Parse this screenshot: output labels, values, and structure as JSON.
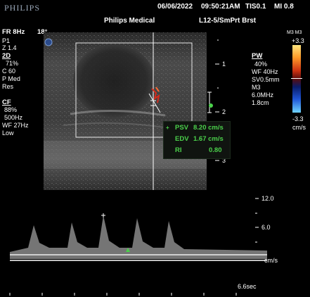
{
  "header": {
    "brand": "PHILIPS",
    "date": "06/06/2022",
    "time": "09:50:21AM",
    "tis": "TIS0.1",
    "mi": "MI 0.8",
    "institution": "Philips Medical",
    "probe_preset": "L12-5/SmPrt Brst"
  },
  "left_panel": {
    "fr": "FR 8Hz",
    "angle": "18°",
    "p": "P1",
    "z": "Z 1.4",
    "mode_2d": "2D",
    "gain_2d": "71%",
    "c": "C 60",
    "p_med": "P Med",
    "res": "Res",
    "mode_cf": "CF",
    "cf_gain": "88%",
    "cf_prf": "500Hz",
    "cf_wf": "WF 27Hz",
    "cf_low": "Low"
  },
  "pw_panel": {
    "title": "PW",
    "gain": "40%",
    "wf": "WF 40Hz",
    "sv": "SV0.5mm",
    "m": "M3",
    "freq": "6.0MHz",
    "depth": "1.8cm"
  },
  "color_scale": {
    "label": "M3 M3",
    "top": "+3.3",
    "bottom": "-3.3",
    "unit": "cm/s",
    "colors": [
      "#ffe680",
      "#ff9d2a",
      "#cc3212",
      "#5a0c0c",
      "#0a1c6a",
      "#1f55d6",
      "#6fd4ff"
    ]
  },
  "depth_scale": {
    "d1": "1",
    "d2": "2",
    "d3": "3"
  },
  "measurements": {
    "psv_label": "PSV",
    "psv_value": "8.20 cm/s",
    "edv_label": "EDV",
    "edv_value": "1.67 cm/s",
    "ri_label": "RI",
    "ri_value": "0.80"
  },
  "doppler": {
    "scale_top": "12.0",
    "scale_mid": "6.0",
    "unit": "cm/s",
    "time": "6.6sec"
  }
}
